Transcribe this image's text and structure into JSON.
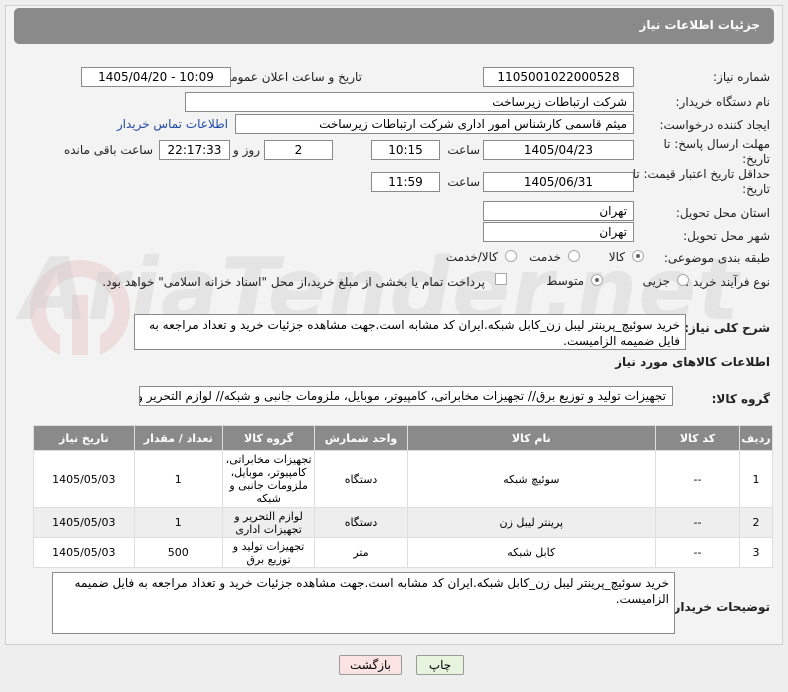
{
  "header": {
    "title": "جزئیات اطلاعات نیاز"
  },
  "form": {
    "need_number_label": "شماره نیاز:",
    "need_number": "1105001022000528",
    "announce_label": "تاریخ و ساعت اعلان عمومی:",
    "announce_value": "1405/04/20 - 10:09",
    "buyer_org_label": "نام دستگاه خریدار:",
    "buyer_org": "شرکت ارتباطات زیرساخت",
    "requester_label": "ایجاد کننده درخواست:",
    "requester": "میثم قاسمی کارشناس امور اداری شرکت ارتباطات زیرساخت",
    "contact_link": "اطلاعات تماس خریدار",
    "reply_deadline_label": "مهلت ارسال پاسخ: تا تاریخ:",
    "reply_date": "1405/04/23",
    "time_label": "ساعت",
    "reply_time": "10:15",
    "days_value": "2",
    "days_label": "روز و",
    "remaining_time": "22:17:33",
    "remaining_label": "ساعت باقی مانده",
    "price_validity_label": "حداقل تاریخ اعتبار قیمت: تا تاریخ:",
    "price_date": "1405/06/31",
    "price_time": "11:59",
    "province_label": "استان محل تحویل:",
    "province": "تهران",
    "city_label": "شهر محل تحویل:",
    "city": "تهران",
    "category_label": "طبقه بندی موضوعی:",
    "cat_goods": "کالا",
    "cat_service": "خدمت",
    "cat_both": "کالا/خدمت",
    "process_label": "نوع فرآیند خرید :",
    "proc_partial": "جزیی",
    "proc_medium": "متوسط",
    "payment_note": "پرداخت تمام یا بخشی از مبلغ خرید،از محل \"اسناد خزانه اسلامی\" خواهد بود.",
    "desc_label": "شرح کلی نیاز:",
    "desc": "خرید سوئیچ_پرینتر لیبل زن_کابل شبکه.ایران کد مشابه است.جهت مشاهده جزئیات خرید و تعداد مراجعه به فایل ضمیمه الزامیست.",
    "goods_info_title": "اطلاعات کالاهای مورد نیاز",
    "goods_group_label": "گروه کالا:",
    "goods_group": "تجهیزات تولید و توزیع برق// تجهیزات مخابراتی، کامپیوتر، موبایل، ملزومات جانبی و شبکه// لوازم التحریر و تجهی"
  },
  "table": {
    "headers": [
      "ردیف",
      "کد کالا",
      "نام کالا",
      "واحد شمارش",
      "گروه کالا",
      "تعداد / مقدار",
      "تاریخ نیاز"
    ],
    "rows": [
      {
        "idx": "1",
        "code": "--",
        "name": "سوئیچ شبکه",
        "unit": "دستگاه",
        "group": "تجهیزات مخابراتی، کامپیوتر، موبایل، ملزومات جانبی و شبکه",
        "qty": "1",
        "date": "1405/05/03"
      },
      {
        "idx": "2",
        "code": "--",
        "name": "پرینتر لیبل زن",
        "unit": "دستگاه",
        "group": "لوازم التحریر و تجهیزات اداری",
        "qty": "1",
        "date": "1405/05/03"
      },
      {
        "idx": "3",
        "code": "--",
        "name": "کابل شبکه",
        "unit": "متر",
        "group": "تجهیزات تولید و توزیع برق",
        "qty": "500",
        "date": "1405/05/03"
      }
    ]
  },
  "buyer_notes_label": "توضیحات خریدار:",
  "buyer_notes": "خرید سوئیچ_پرینتر لیبل زن_کابل شبکه.ایران کد مشابه است.جهت مشاهده جزئیات خرید و تعداد مراجعه به فایل ضمیمه الزامیست.",
  "buttons": {
    "print": "چاپ",
    "back": "بازگشت"
  },
  "watermark": "AriaTender.net",
  "colors": {
    "header_bg": "#8a8a8a",
    "link": "#1f4aa8",
    "back_btn": "#fbe3e3",
    "print_btn": "#e6f3dd"
  }
}
